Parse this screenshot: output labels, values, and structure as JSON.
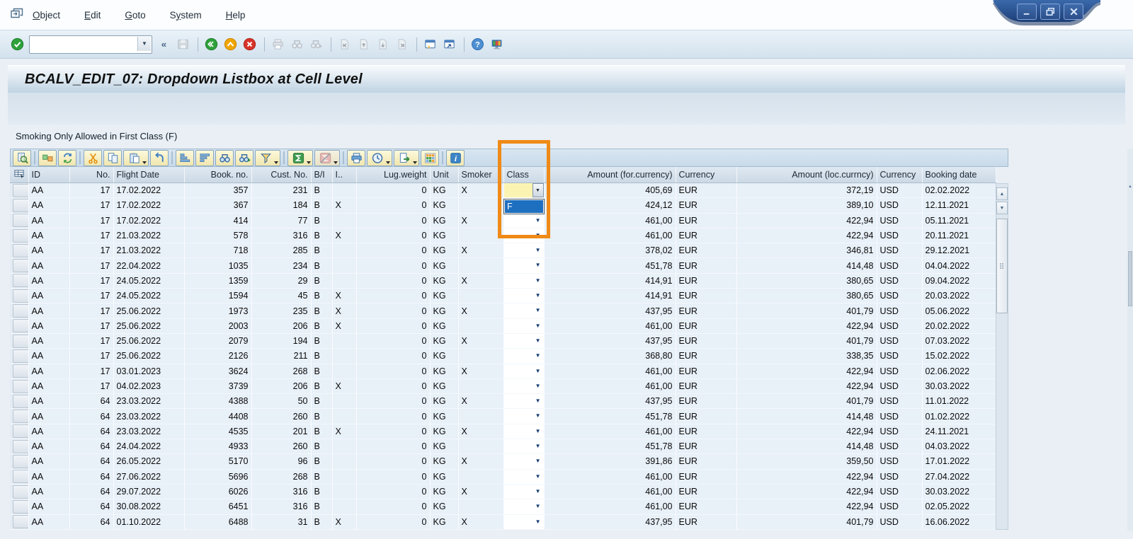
{
  "title": "BCALV_EDIT_07: Dropdown Listbox at Cell Level",
  "note": "Smoking Only Allowed in First Class (F)",
  "colors": {
    "highlight_box": "#F08A17",
    "selected_option_bg": "#1D6FC0",
    "combo_cell_bg": "#FBF3B2",
    "grid_row_bg": "#E8F0F8",
    "header_bg": "#D5E0EA"
  },
  "window": {
    "controls": [
      {
        "name": "minimize"
      },
      {
        "name": "restore"
      },
      {
        "name": "close"
      }
    ]
  },
  "menubar": {
    "items": [
      {
        "label": "Object",
        "underline": 0
      },
      {
        "label": "Edit",
        "underline": 0
      },
      {
        "label": "Goto",
        "underline": 0
      },
      {
        "label": "System",
        "underline": 1
      },
      {
        "label": "Help",
        "underline": 0
      }
    ]
  },
  "system_toolbar": {
    "command_field": {
      "value": "",
      "placeholder": ""
    },
    "items": [
      {
        "icon": "enter-icon",
        "enabled": true
      },
      {
        "icon": "command-field",
        "enabled": true
      },
      {
        "icon": "collapse-icon",
        "enabled": true
      },
      {
        "icon": "save-icon",
        "enabled": false
      },
      {
        "sep": true
      },
      {
        "icon": "back-icon",
        "enabled": true
      },
      {
        "icon": "up-icon",
        "enabled": true
      },
      {
        "icon": "cancel-icon",
        "enabled": true
      },
      {
        "sep": true
      },
      {
        "icon": "print-icon",
        "enabled": false
      },
      {
        "icon": "find-icon",
        "enabled": false
      },
      {
        "icon": "find-next-icon",
        "enabled": false
      },
      {
        "sep": true
      },
      {
        "icon": "first-page-icon",
        "enabled": false
      },
      {
        "icon": "prev-page-icon",
        "enabled": false
      },
      {
        "icon": "next-page-icon",
        "enabled": false
      },
      {
        "icon": "last-page-icon",
        "enabled": false
      },
      {
        "sep": true
      },
      {
        "icon": "new-session-icon",
        "enabled": true
      },
      {
        "icon": "shortcut-icon",
        "enabled": true
      },
      {
        "sep": true
      },
      {
        "icon": "help-icon",
        "enabled": true
      },
      {
        "icon": "customize-icon",
        "enabled": true
      }
    ]
  },
  "grid": {
    "toolbar": [
      {
        "icon": "details-icon"
      },
      {
        "sep": true
      },
      {
        "icon": "check-icon"
      },
      {
        "icon": "refresh-icon"
      },
      {
        "sep": true
      },
      {
        "icon": "cut-icon"
      },
      {
        "icon": "copy-icon"
      },
      {
        "icon": "paste-icon",
        "dropdown": true
      },
      {
        "icon": "undo-icon"
      },
      {
        "sep": true
      },
      {
        "icon": "sort-asc-icon"
      },
      {
        "icon": "sort-desc-icon"
      },
      {
        "icon": "find-grid-icon"
      },
      {
        "icon": "find-next-grid-icon"
      },
      {
        "icon": "filter-icon",
        "dropdown": true
      },
      {
        "sep": true
      },
      {
        "icon": "sum-icon",
        "dropdown": true
      },
      {
        "icon": "subtotal-icon",
        "dropdown": true,
        "enabled": false
      },
      {
        "sep": true
      },
      {
        "icon": "print-grid-icon"
      },
      {
        "icon": "views-icon",
        "dropdown": true
      },
      {
        "icon": "export-icon",
        "dropdown": true
      },
      {
        "icon": "layout-icon"
      },
      {
        "sep": true
      },
      {
        "icon": "info-icon"
      }
    ],
    "columns": [
      "ID",
      "No.",
      "Flight Date",
      "Book. no.",
      "Cust. No.",
      "B/I",
      "I..",
      "Lug.weight",
      "Unit",
      "Smoker",
      "Class",
      "Amount (for.currency)",
      "Currency",
      "Amount (loc.currncy)",
      "Currency",
      "Booking date"
    ],
    "class_dropdown": {
      "open_row_index": 0,
      "visible_options": [
        "F"
      ],
      "highlighted_option": "F",
      "selected_value": ""
    },
    "rows": [
      [
        "AA",
        "17",
        "17.02.2022",
        "357",
        "231",
        "B",
        "",
        "0",
        "KG",
        "X",
        "",
        "405,69",
        "EUR",
        "372,19",
        "USD",
        "02.02.2022"
      ],
      [
        "AA",
        "17",
        "17.02.2022",
        "367",
        "184",
        "B",
        "X",
        "0",
        "KG",
        "",
        "",
        "424,12",
        "EUR",
        "389,10",
        "USD",
        "12.11.2021"
      ],
      [
        "AA",
        "17",
        "17.02.2022",
        "414",
        "77",
        "B",
        "",
        "0",
        "KG",
        "X",
        "",
        "461,00",
        "EUR",
        "422,94",
        "USD",
        "05.11.2021"
      ],
      [
        "AA",
        "17",
        "21.03.2022",
        "578",
        "316",
        "B",
        "X",
        "0",
        "KG",
        "",
        "",
        "461,00",
        "EUR",
        "422,94",
        "USD",
        "20.11.2021"
      ],
      [
        "AA",
        "17",
        "21.03.2022",
        "718",
        "285",
        "B",
        "",
        "0",
        "KG",
        "X",
        "",
        "378,02",
        "EUR",
        "346,81",
        "USD",
        "29.12.2021"
      ],
      [
        "AA",
        "17",
        "22.04.2022",
        "1035",
        "234",
        "B",
        "",
        "0",
        "KG",
        "",
        "",
        "451,78",
        "EUR",
        "414,48",
        "USD",
        "04.04.2022"
      ],
      [
        "AA",
        "17",
        "24.05.2022",
        "1359",
        "29",
        "B",
        "",
        "0",
        "KG",
        "X",
        "",
        "414,91",
        "EUR",
        "380,65",
        "USD",
        "09.04.2022"
      ],
      [
        "AA",
        "17",
        "24.05.2022",
        "1594",
        "45",
        "B",
        "X",
        "0",
        "KG",
        "",
        "",
        "414,91",
        "EUR",
        "380,65",
        "USD",
        "20.03.2022"
      ],
      [
        "AA",
        "17",
        "25.06.2022",
        "1973",
        "235",
        "B",
        "X",
        "0",
        "KG",
        "X",
        "",
        "437,95",
        "EUR",
        "401,79",
        "USD",
        "05.06.2022"
      ],
      [
        "AA",
        "17",
        "25.06.2022",
        "2003",
        "206",
        "B",
        "X",
        "0",
        "KG",
        "",
        "",
        "461,00",
        "EUR",
        "422,94",
        "USD",
        "20.02.2022"
      ],
      [
        "AA",
        "17",
        "25.06.2022",
        "2079",
        "194",
        "B",
        "",
        "0",
        "KG",
        "X",
        "",
        "437,95",
        "EUR",
        "401,79",
        "USD",
        "07.03.2022"
      ],
      [
        "AA",
        "17",
        "25.06.2022",
        "2126",
        "211",
        "B",
        "",
        "0",
        "KG",
        "",
        "",
        "368,80",
        "EUR",
        "338,35",
        "USD",
        "15.02.2022"
      ],
      [
        "AA",
        "17",
        "03.01.2023",
        "3624",
        "268",
        "B",
        "",
        "0",
        "KG",
        "X",
        "",
        "461,00",
        "EUR",
        "422,94",
        "USD",
        "02.06.2022"
      ],
      [
        "AA",
        "17",
        "04.02.2023",
        "3739",
        "206",
        "B",
        "X",
        "0",
        "KG",
        "",
        "",
        "461,00",
        "EUR",
        "422,94",
        "USD",
        "30.03.2022"
      ],
      [
        "AA",
        "64",
        "23.03.2022",
        "4388",
        "50",
        "B",
        "",
        "0",
        "KG",
        "X",
        "",
        "437,95",
        "EUR",
        "401,79",
        "USD",
        "11.01.2022"
      ],
      [
        "AA",
        "64",
        "23.03.2022",
        "4408",
        "260",
        "B",
        "",
        "0",
        "KG",
        "",
        "",
        "451,78",
        "EUR",
        "414,48",
        "USD",
        "01.02.2022"
      ],
      [
        "AA",
        "64",
        "23.03.2022",
        "4535",
        "201",
        "B",
        "X",
        "0",
        "KG",
        "X",
        "",
        "461,00",
        "EUR",
        "422,94",
        "USD",
        "24.11.2021"
      ],
      [
        "AA",
        "64",
        "24.04.2022",
        "4933",
        "260",
        "B",
        "",
        "0",
        "KG",
        "",
        "",
        "451,78",
        "EUR",
        "414,48",
        "USD",
        "04.03.2022"
      ],
      [
        "AA",
        "64",
        "26.05.2022",
        "5170",
        "96",
        "B",
        "",
        "0",
        "KG",
        "X",
        "",
        "391,86",
        "EUR",
        "359,50",
        "USD",
        "17.01.2022"
      ],
      [
        "AA",
        "64",
        "27.06.2022",
        "5696",
        "268",
        "B",
        "",
        "0",
        "KG",
        "",
        "",
        "461,00",
        "EUR",
        "422,94",
        "USD",
        "27.04.2022"
      ],
      [
        "AA",
        "64",
        "29.07.2022",
        "6026",
        "316",
        "B",
        "",
        "0",
        "KG",
        "X",
        "",
        "461,00",
        "EUR",
        "422,94",
        "USD",
        "30.03.2022"
      ],
      [
        "AA",
        "64",
        "30.08.2022",
        "6451",
        "316",
        "B",
        "",
        "0",
        "KG",
        "",
        "",
        "461,00",
        "EUR",
        "422,94",
        "USD",
        "02.05.2022"
      ],
      [
        "AA",
        "64",
        "01.10.2022",
        "6488",
        "31",
        "B",
        "X",
        "0",
        "KG",
        "X",
        "",
        "437,95",
        "EUR",
        "401,79",
        "USD",
        "16.06.2022"
      ]
    ]
  }
}
